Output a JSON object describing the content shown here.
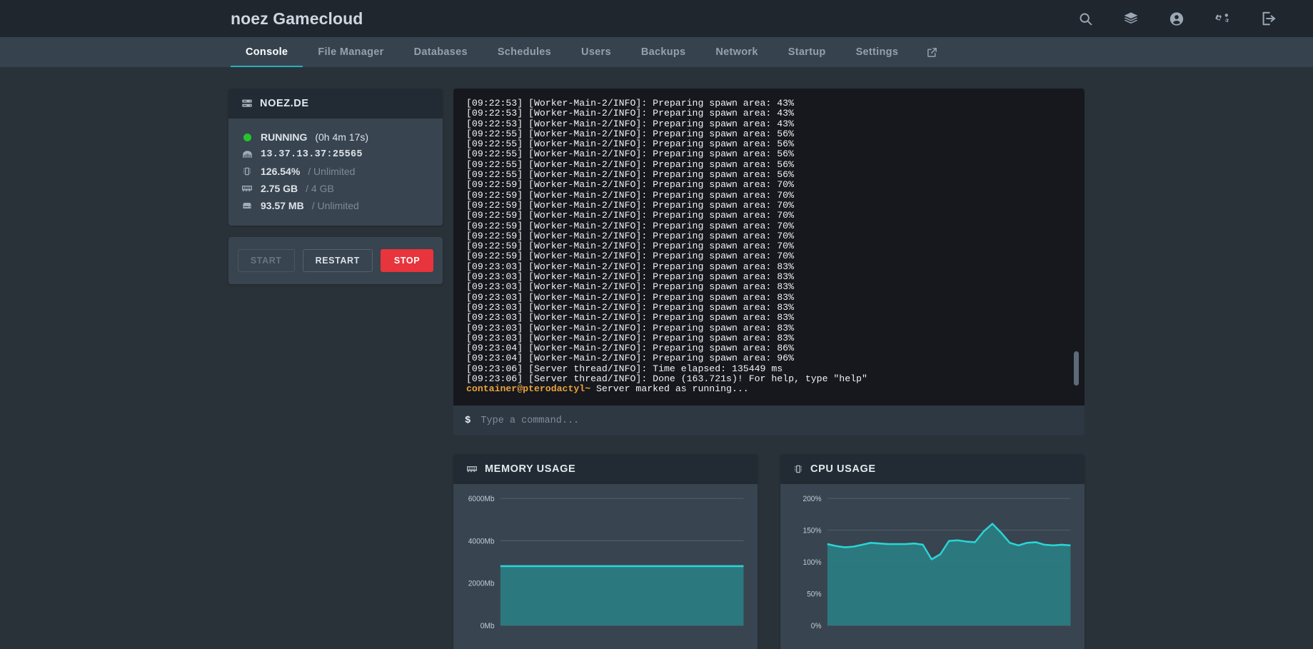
{
  "header": {
    "brand": "noez Gamecloud",
    "icons": [
      {
        "name": "search-icon",
        "label": "Search"
      },
      {
        "name": "layers-icon",
        "label": "Servers"
      },
      {
        "name": "account-icon",
        "label": "Account"
      },
      {
        "name": "settings-gears-icon",
        "label": "Admin"
      },
      {
        "name": "logout-icon",
        "label": "Sign Out"
      }
    ]
  },
  "nav": {
    "tabs": [
      {
        "label": "Console",
        "active": true
      },
      {
        "label": "File Manager",
        "active": false
      },
      {
        "label": "Databases",
        "active": false
      },
      {
        "label": "Schedules",
        "active": false
      },
      {
        "label": "Users",
        "active": false
      },
      {
        "label": "Backups",
        "active": false
      },
      {
        "label": "Network",
        "active": false
      },
      {
        "label": "Startup",
        "active": false
      },
      {
        "label": "Settings",
        "active": false
      }
    ],
    "external_icon": "external-link-icon"
  },
  "server": {
    "title": "NOEZ.DE",
    "status": "RUNNING",
    "uptime": "(0h 4m 17s)",
    "address": "13.37.13.37:25565",
    "cpu_value": "126.54%",
    "cpu_limit": "/ Unlimited",
    "memory_value": "2.75 GB",
    "memory_limit": "/ 4 GB",
    "disk_value": "93.57 MB",
    "disk_limit": "/ Unlimited",
    "status_color": "#25c52a"
  },
  "power": {
    "start": "START",
    "restart": "RESTART",
    "stop": "STOP",
    "stop_color": "#e8343c"
  },
  "console": {
    "lines": [
      "[09:22:53] [Worker-Main-2/INFO]: Preparing spawn area: 43%",
      "[09:22:53] [Worker-Main-2/INFO]: Preparing spawn area: 43%",
      "[09:22:53] [Worker-Main-2/INFO]: Preparing spawn area: 43%",
      "[09:22:55] [Worker-Main-2/INFO]: Preparing spawn area: 56%",
      "[09:22:55] [Worker-Main-2/INFO]: Preparing spawn area: 56%",
      "[09:22:55] [Worker-Main-2/INFO]: Preparing spawn area: 56%",
      "[09:22:55] [Worker-Main-2/INFO]: Preparing spawn area: 56%",
      "[09:22:55] [Worker-Main-2/INFO]: Preparing spawn area: 56%",
      "[09:22:59] [Worker-Main-2/INFO]: Preparing spawn area: 70%",
      "[09:22:59] [Worker-Main-2/INFO]: Preparing spawn area: 70%",
      "[09:22:59] [Worker-Main-2/INFO]: Preparing spawn area: 70%",
      "[09:22:59] [Worker-Main-2/INFO]: Preparing spawn area: 70%",
      "[09:22:59] [Worker-Main-2/INFO]: Preparing spawn area: 70%",
      "[09:22:59] [Worker-Main-2/INFO]: Preparing spawn area: 70%",
      "[09:22:59] [Worker-Main-2/INFO]: Preparing spawn area: 70%",
      "[09:22:59] [Worker-Main-2/INFO]: Preparing spawn area: 70%",
      "[09:23:03] [Worker-Main-2/INFO]: Preparing spawn area: 83%",
      "[09:23:03] [Worker-Main-2/INFO]: Preparing spawn area: 83%",
      "[09:23:03] [Worker-Main-2/INFO]: Preparing spawn area: 83%",
      "[09:23:03] [Worker-Main-2/INFO]: Preparing spawn area: 83%",
      "[09:23:03] [Worker-Main-2/INFO]: Preparing spawn area: 83%",
      "[09:23:03] [Worker-Main-2/INFO]: Preparing spawn area: 83%",
      "[09:23:03] [Worker-Main-2/INFO]: Preparing spawn area: 83%",
      "[09:23:03] [Worker-Main-2/INFO]: Preparing spawn area: 83%",
      "[09:23:04] [Worker-Main-2/INFO]: Preparing spawn area: 86%",
      "[09:23:04] [Worker-Main-2/INFO]: Preparing spawn area: 96%",
      "[09:23:06] [Server thread/INFO]: Time elapsed: 135449 ms",
      "[09:23:06] [Server thread/INFO]: Done (163.721s)! For help, type \"help\""
    ],
    "final_prompt": "container@pterodactyl~",
    "final_message": " Server marked as running...",
    "prompt_symbol": "$",
    "input_placeholder": "Type a command...",
    "input_value": ""
  },
  "chart_data": [
    {
      "type": "area",
      "title": "MEMORY USAGE",
      "icon": "ram-icon",
      "ylabel": "",
      "xlabel": "",
      "ylim": [
        0,
        6000
      ],
      "yticks": [
        0,
        2000,
        4000,
        6000
      ],
      "ytick_labels": [
        "0Mb",
        "2000Mb",
        "4000Mb",
        "6000Mb"
      ],
      "grid": true,
      "line_color": "#2ad4d4",
      "fill_color": "#2a7b82",
      "values": [
        2800,
        2800,
        2800,
        2800,
        2800,
        2800,
        2800,
        2800,
        2800,
        2800,
        2800,
        2800,
        2800,
        2800,
        2800,
        2800,
        2800,
        2800,
        2800,
        2800,
        2800
      ]
    },
    {
      "type": "area",
      "title": "CPU USAGE",
      "icon": "cpu-icon",
      "ylabel": "",
      "xlabel": "",
      "ylim": [
        0,
        200
      ],
      "yticks": [
        0,
        50,
        100,
        150,
        200
      ],
      "ytick_labels": [
        "0%",
        "50%",
        "100%",
        "150%",
        "200%"
      ],
      "grid": true,
      "line_color": "#2ad4d4",
      "fill_color": "#2a7b82",
      "values": [
        128,
        125,
        123,
        124,
        127,
        130,
        129,
        128,
        128,
        128,
        129,
        127,
        104,
        112,
        133,
        134,
        132,
        131,
        148,
        160,
        146,
        130,
        126,
        130,
        131,
        127,
        126,
        127,
        126
      ]
    }
  ]
}
